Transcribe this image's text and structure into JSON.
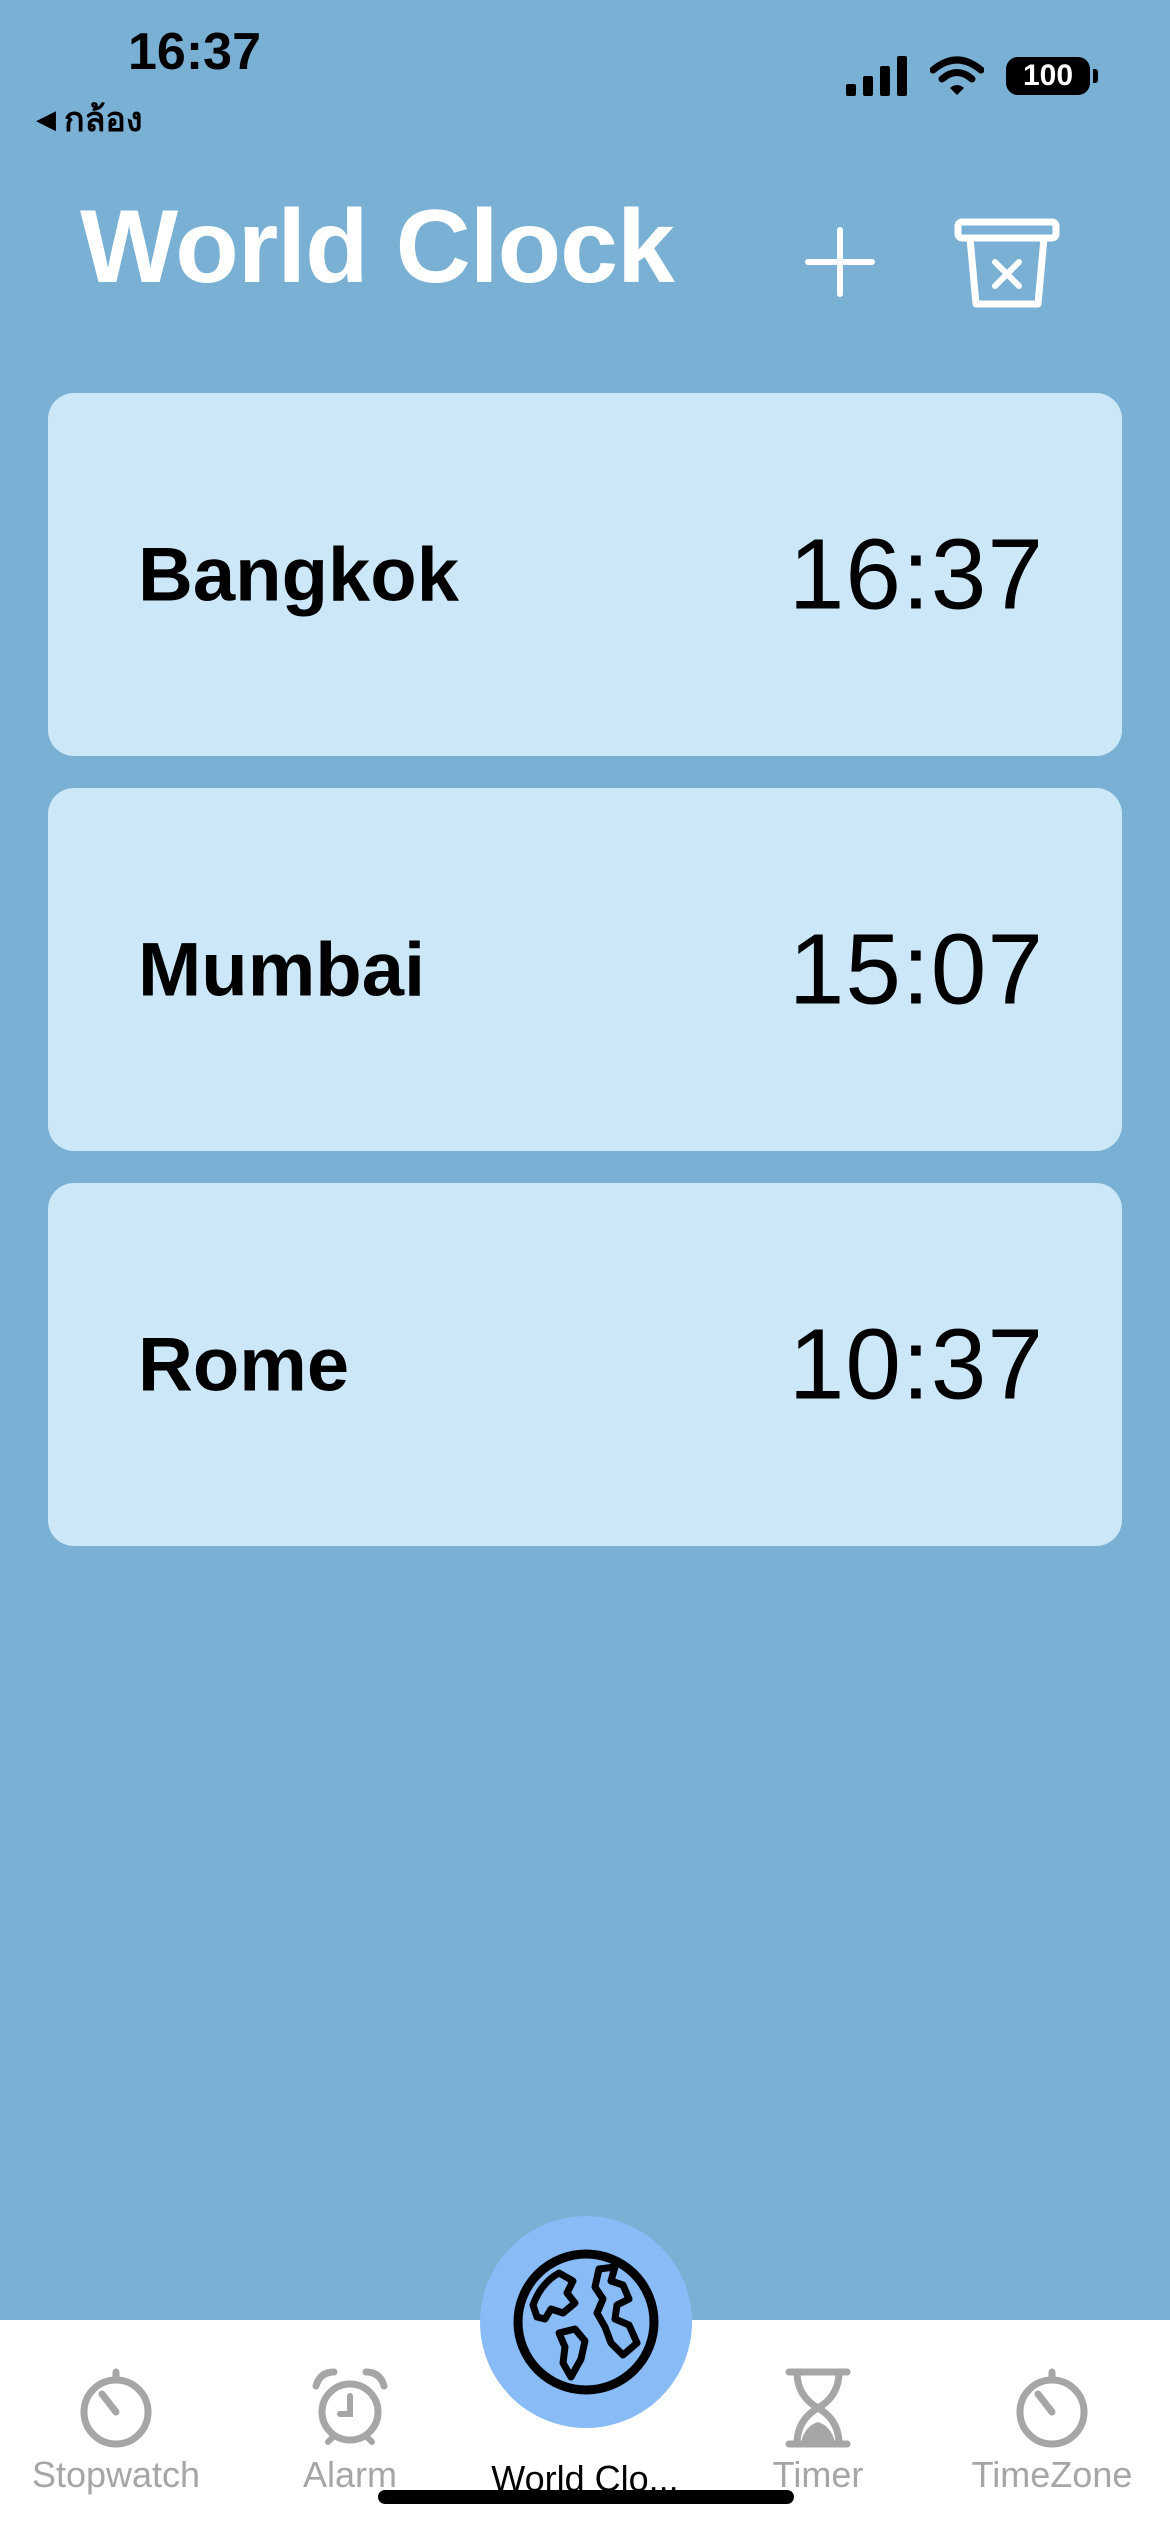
{
  "status_bar": {
    "time": "16:37",
    "back_label": "กล้อง",
    "battery": "100"
  },
  "header": {
    "title": "World Clock",
    "add_icon": "plus-icon",
    "delete_icon": "trash-x-icon"
  },
  "clocks": [
    {
      "city": "Bangkok",
      "time": "16:37"
    },
    {
      "city": "Mumbai",
      "time": "15:07"
    },
    {
      "city": "Rome",
      "time": "10:37"
    }
  ],
  "tabs": [
    {
      "label": "Stopwatch",
      "icon": "stopwatch-icon",
      "active": false
    },
    {
      "label": "Alarm",
      "icon": "alarm-clock-icon",
      "active": false
    },
    {
      "label": "World Clo...",
      "icon": "globe-icon",
      "active": true
    },
    {
      "label": "Timer",
      "icon": "hourglass-icon",
      "active": false
    },
    {
      "label": "TimeZone",
      "icon": "stopwatch-icon",
      "active": false
    }
  ],
  "colors": {
    "background": "#7ab0d4",
    "card": "#cce8f8",
    "active_tab_bubble": "#89bbf6",
    "inactive_tab": "#a6a6a6"
  }
}
